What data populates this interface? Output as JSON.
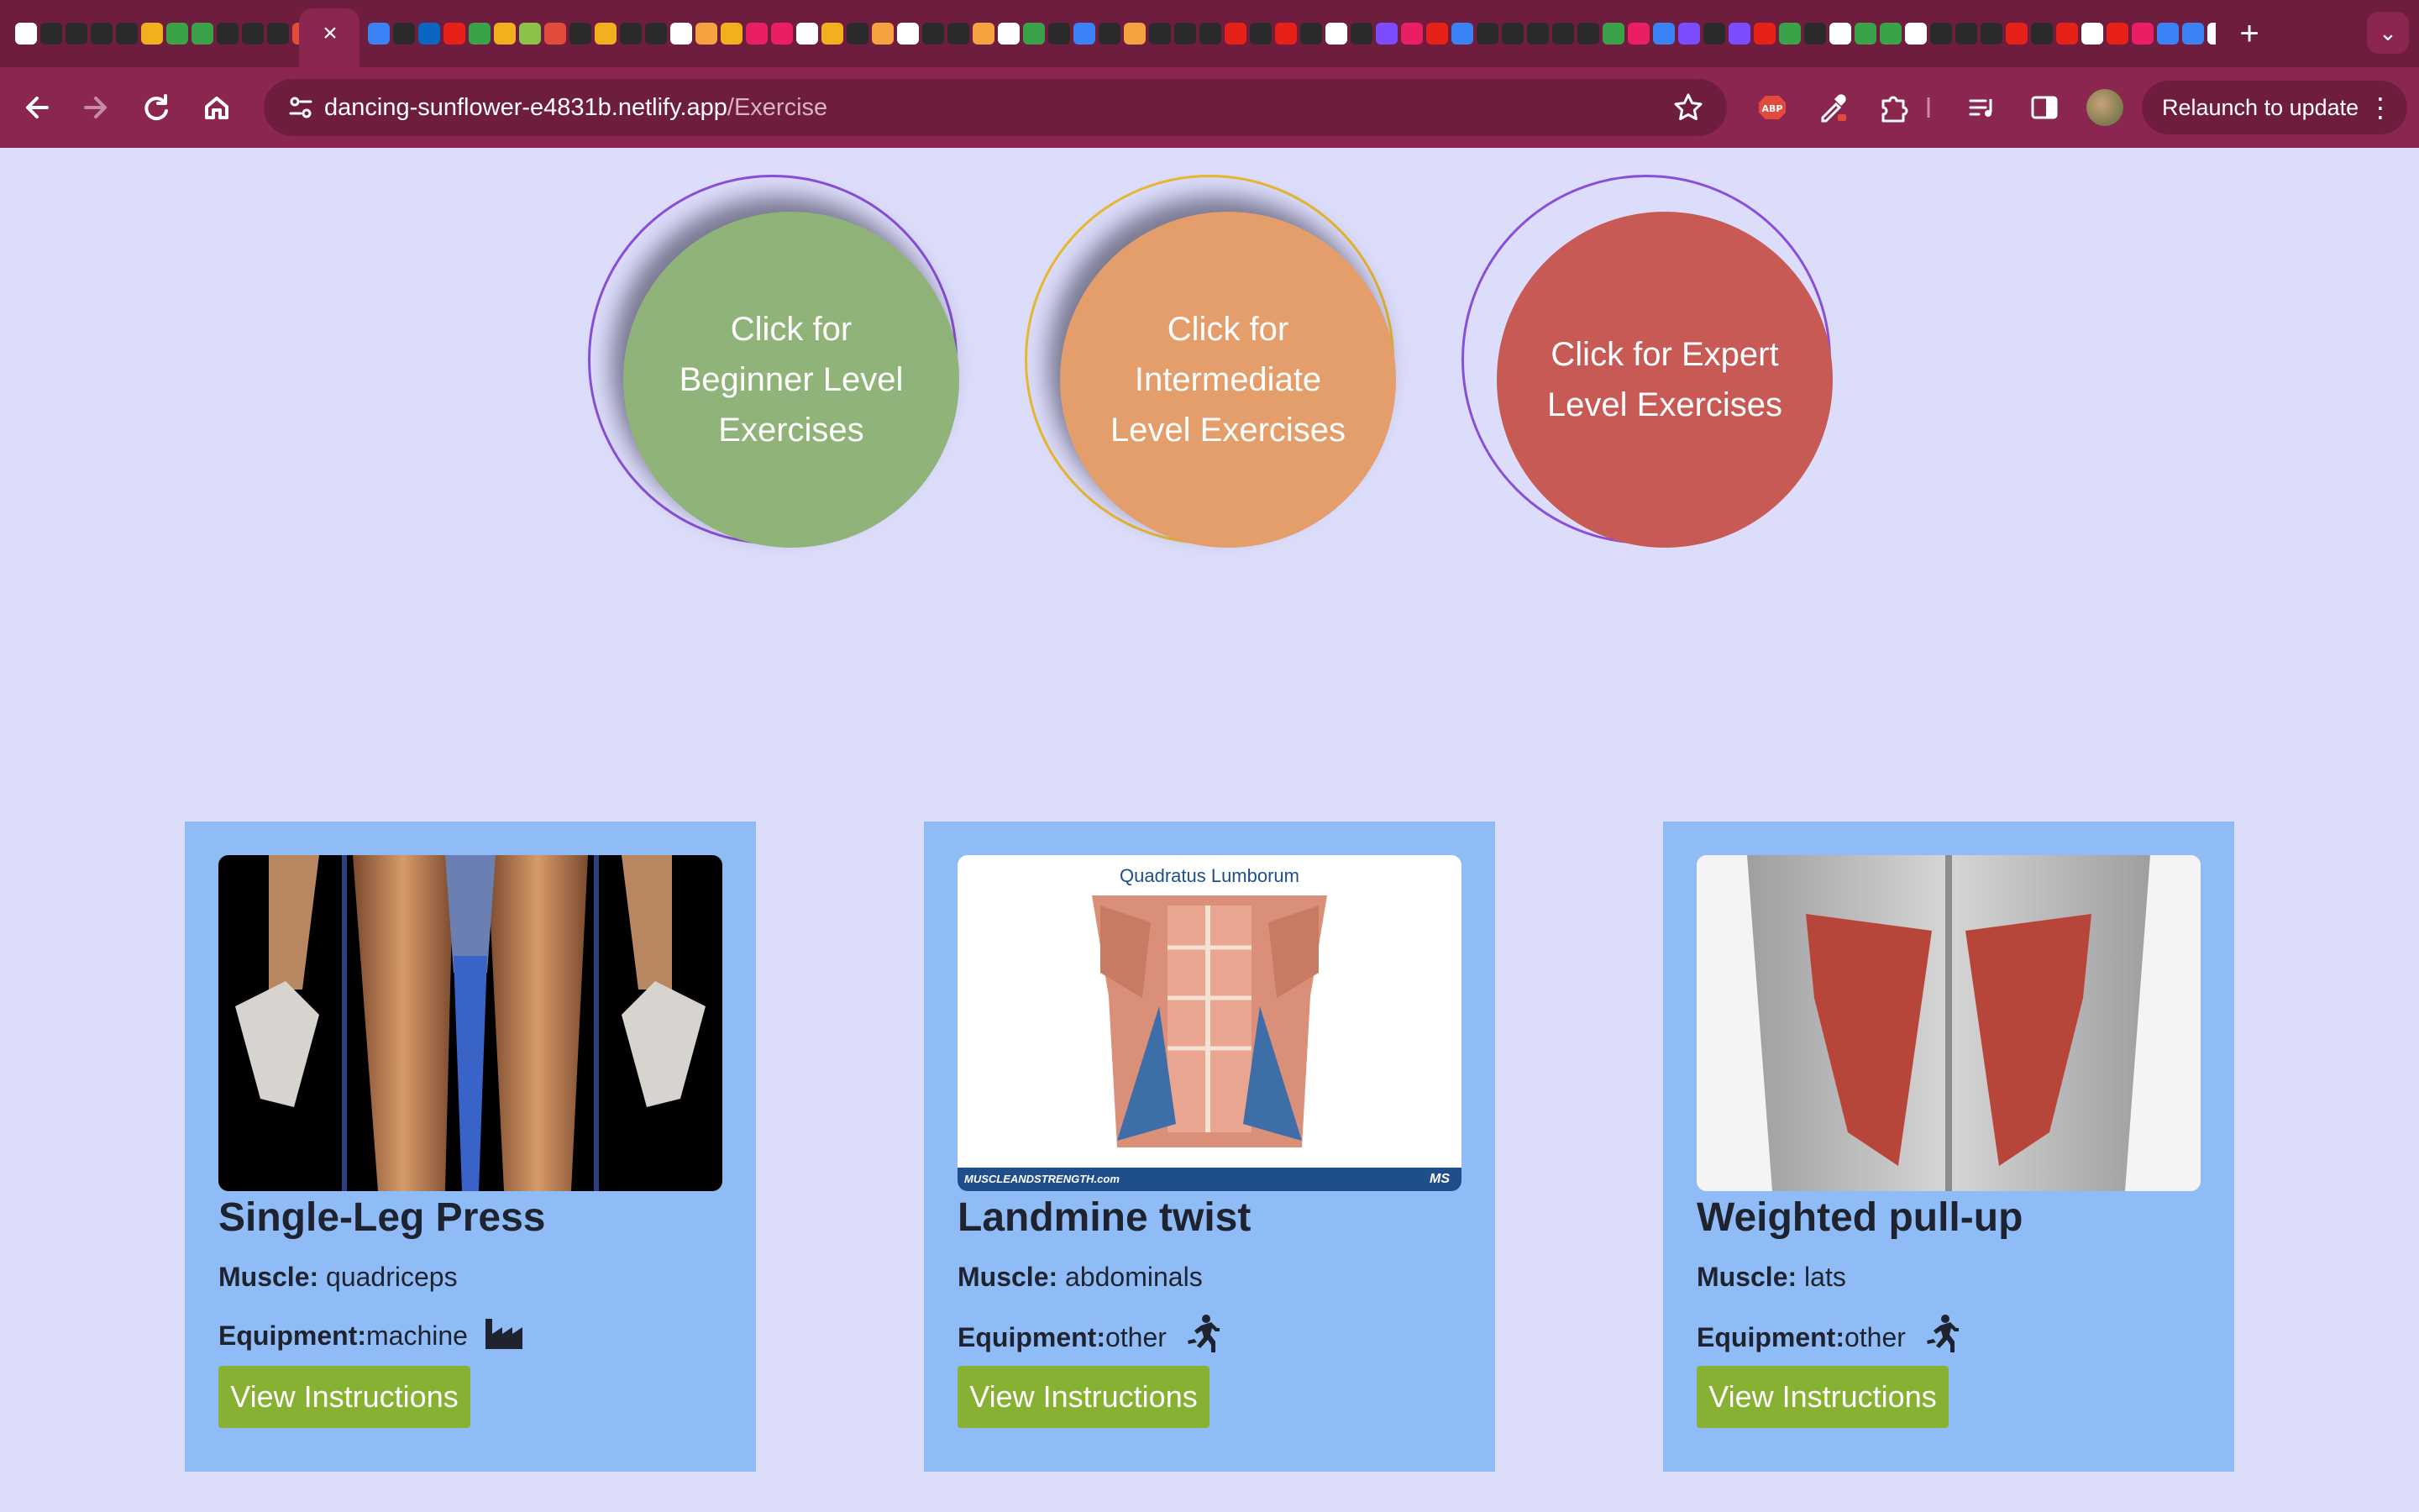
{
  "browser": {
    "tab_close_glyph": "×",
    "new_tab_glyph": "+",
    "tab_search_glyph": "⌄",
    "url_host": "dancing-sunflower-e4831b.netlify.app",
    "url_path": "/Exercise",
    "relaunch_label": "Relaunch to update",
    "tab_favicon_colors": [
      "#ffffff",
      "#2a2a2a",
      "#2a2a2a",
      "#2a2a2a",
      "#2a2a2a",
      "#f2b01e",
      "#3aa34a",
      "#3aa34a",
      "#2a2a2a",
      "#2a2a2a",
      "#2a2a2a",
      "#e24a3b",
      "#ffffff",
      "#f4a340",
      "#3b82f6",
      "#2a2a2a",
      "#0a66c2",
      "#e62117",
      "#3aa34a",
      "#f2b01e",
      "#8bc34a",
      "#e24a3b",
      "#2a2a2a",
      "#f2b01e",
      "#2a2a2a",
      "#2a2a2a",
      "#ffffff",
      "#f4a340",
      "#f2b01e",
      "#e91e63",
      "#e91e63",
      "#ffffff",
      "#f2b01e",
      "#2a2a2a",
      "#f4a340",
      "#ffffff",
      "#2a2a2a",
      "#2a2a2a",
      "#f4a340",
      "#ffffff",
      "#3aa34a",
      "#2a2a2a",
      "#3b82f6",
      "#2a2a2a",
      "#f4a340",
      "#2a2a2a",
      "#2a2a2a",
      "#2a2a2a",
      "#e62117",
      "#2a2a2a",
      "#e62117",
      "#2a2a2a",
      "#ffffff",
      "#2a2a2a",
      "#7c4dff",
      "#e91e63",
      "#e62117",
      "#3b82f6",
      "#2a2a2a",
      "#2a2a2a",
      "#2a2a2a",
      "#2a2a2a",
      "#2a2a2a",
      "#3aa34a",
      "#e91e63",
      "#3b82f6",
      "#7c4dff",
      "#2a2a2a",
      "#7c4dff",
      "#e62117",
      "#3aa34a",
      "#2a2a2a",
      "#ffffff",
      "#3aa34a",
      "#3aa34a",
      "#ffffff",
      "#2a2a2a",
      "#2a2a2a",
      "#2a2a2a",
      "#e62117",
      "#2a2a2a",
      "#e62117",
      "#ffffff",
      "#e62117",
      "#e91e63",
      "#3b82f6",
      "#3b82f6",
      "#ffffff"
    ]
  },
  "levels": [
    {
      "label": "Click for Beginner Level Exercises",
      "color": "#8fb378",
      "ring": "#8a4fd8"
    },
    {
      "label": "Click for Intermediate Level Exercises",
      "color": "#e39e6b",
      "ring": "#e8b82e"
    },
    {
      "label": "Click for Expert Level Exercises",
      "color": "#c75a55",
      "ring": "#8a4fd8"
    }
  ],
  "cards": [
    {
      "title": "Single-Leg Press",
      "muscle_label": "Muscle:",
      "muscle": "quadriceps",
      "equipment_label": "Equipment:",
      "equipment": "machine",
      "equipment_icon": "factory-icon",
      "button": "View Instructions",
      "image_subject": "leg-muscles-illustration"
    },
    {
      "title": "Landmine twist",
      "muscle_label": "Muscle:",
      "muscle": "abdominals",
      "equipment_label": "Equipment:",
      "equipment": "other",
      "equipment_icon": "running-person-icon",
      "button": "View Instructions",
      "image_caption": "Quadratus Lumborum",
      "image_footer": "MUSCLEANDSTRENGTH.com",
      "image_logo": "MS",
      "image_subject": "abdominal-muscles-illustration"
    },
    {
      "title": "Weighted pull-up",
      "muscle_label": "Muscle:",
      "muscle": "lats",
      "equipment_label": "Equipment:",
      "equipment": "other",
      "equipment_icon": "running-person-icon",
      "button": "View Instructions",
      "image_subject": "back-lats-illustration"
    }
  ],
  "colors": {
    "page_bg": "#dcdcfb",
    "card_bg": "#8fbcf6",
    "button_bg": "#86b133",
    "chrome_frame": "#6e1d3f",
    "chrome_toolbar": "#8a2650"
  }
}
